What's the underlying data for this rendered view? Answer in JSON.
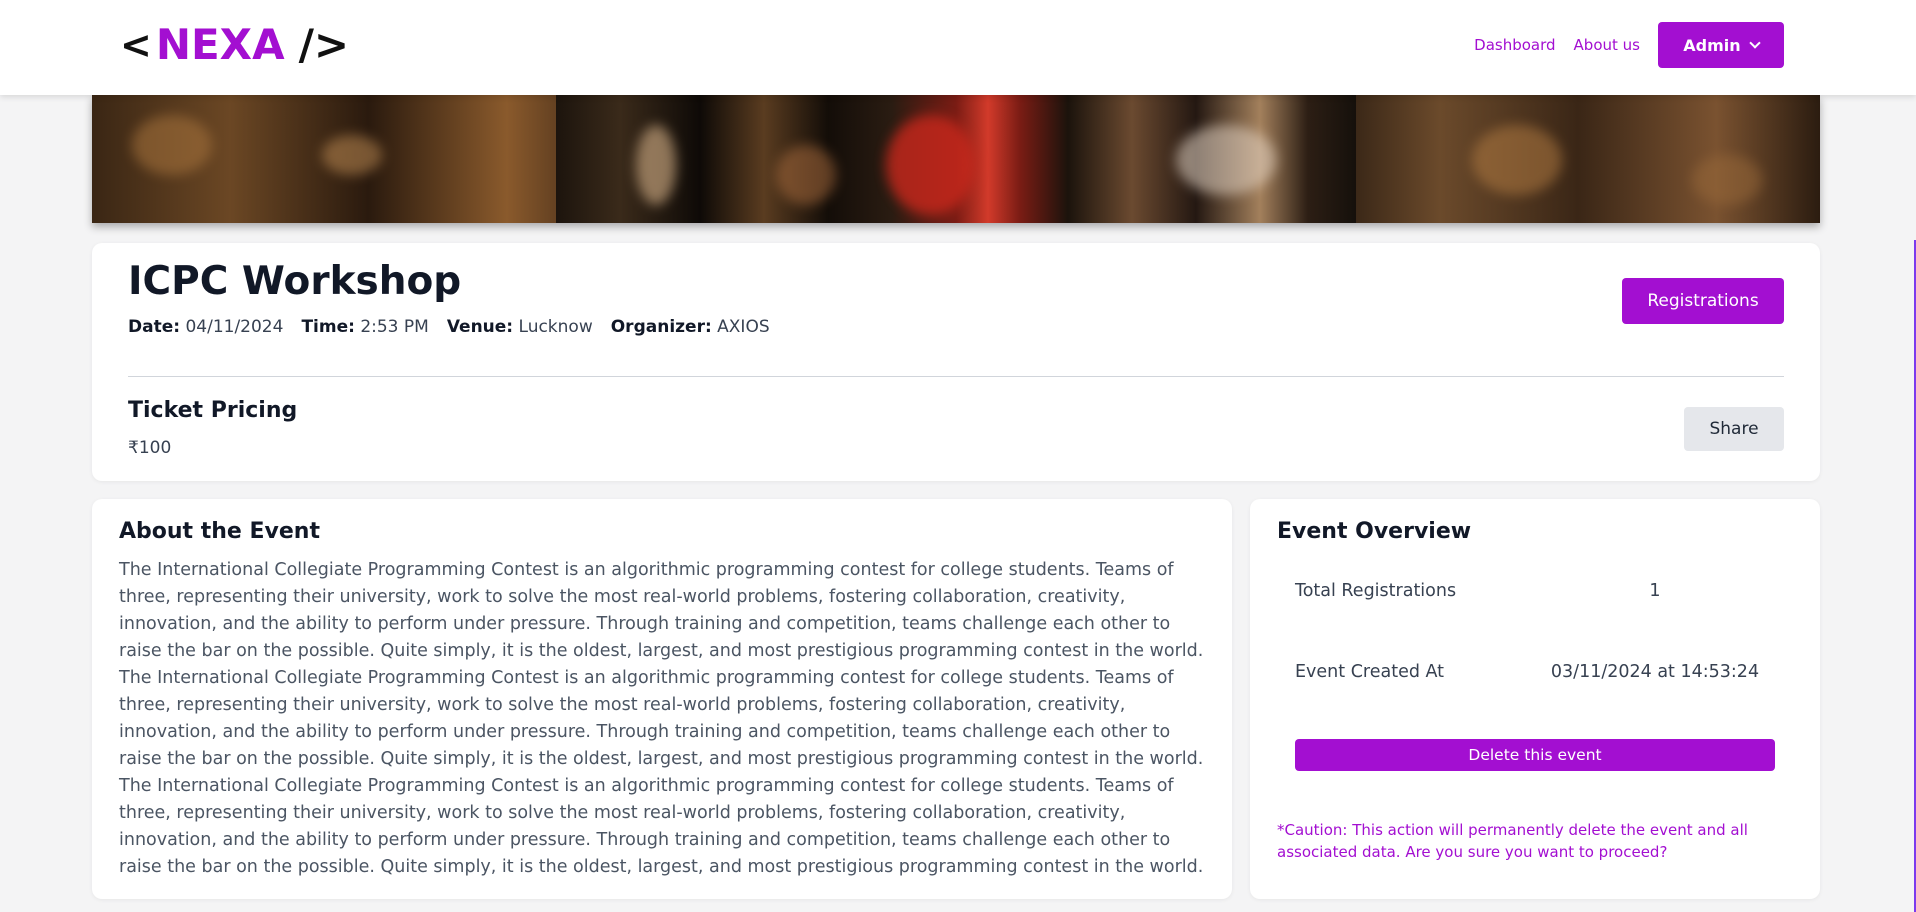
{
  "header": {
    "logo": {
      "open": "<",
      "brand": "NEXA",
      "close": "/>"
    },
    "nav": {
      "dashboard": "Dashboard",
      "about": "About us"
    },
    "admin_label": "Admin"
  },
  "event": {
    "title": "ICPC Workshop",
    "meta": {
      "date_label": "Date:",
      "date": "04/11/2024",
      "time_label": "Time:",
      "time": "2:53 PM",
      "venue_label": "Venue:",
      "venue": "Lucknow",
      "organizer_label": "Organizer:",
      "organizer": "AXIOS"
    },
    "registrations_button": "Registrations",
    "ticket_pricing_title": "Ticket Pricing",
    "ticket_price": "₹100",
    "share_button": "Share"
  },
  "about": {
    "title": "About the Event",
    "paragraphs": [
      "The International Collegiate Programming Contest is an algorithmic programming contest for college students. Teams of three, representing their university, work to solve the most real-world problems, fostering collaboration, creativity, innovation, and the ability to perform under pressure. Through training and competition, teams challenge each other to raise the bar on the possible. Quite simply, it is the oldest, largest, and most prestigious programming contest in the world.",
      "The International Collegiate Programming Contest is an algorithmic programming contest for college students. Teams of three, representing their university, work to solve the most real-world problems, fostering collaboration, creativity, innovation, and the ability to perform under pressure. Through training and competition, teams challenge each other to raise the bar on the possible. Quite simply, it is the oldest, largest, and most prestigious programming contest in the world.",
      "The International Collegiate Programming Contest is an algorithmic programming contest for college students. Teams of three, representing their university, work to solve the most real-world problems, fostering collaboration, creativity, innovation, and the ability to perform under pressure. Through training and competition, teams challenge each other to raise the bar on the possible. Quite simply, it is the oldest, largest, and most prestigious programming contest in the world."
    ]
  },
  "overview": {
    "title": "Event Overview",
    "rows": [
      {
        "label": "Total Registrations",
        "value": "1"
      },
      {
        "label": "Event Created At",
        "value": "03/11/2024 at 14:53:24"
      }
    ],
    "delete_button": "Delete this event",
    "caution": "*Caution: This action will permanently delete the event and all associated data. Are you sure you want to proceed?"
  },
  "colors": {
    "accent": "#a30fd1",
    "background": "#f4f4f5"
  }
}
